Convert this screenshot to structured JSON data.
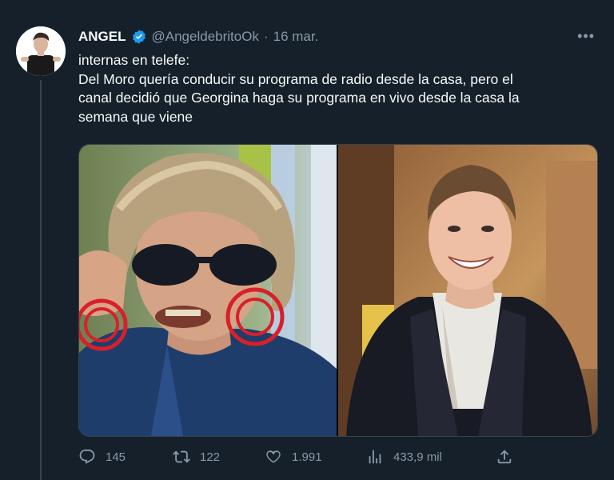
{
  "author": {
    "name": "ANGEL",
    "handle": "@AngeldebritoOk",
    "separator": "·",
    "date": "16 mar."
  },
  "tweet": {
    "lines": [
      "internas en telefe:",
      "Del Moro quería conducir su programa de radio desde la casa, pero el",
      "canal decidió que Georgina haga su programa en vivo desde la casa la",
      "semana que viene"
    ]
  },
  "actions": {
    "replies": "145",
    "retweets": "122",
    "likes": "1.991",
    "views": "433,9 mil"
  },
  "colors": {
    "background": "#15202b",
    "verified": "#1d9bf0",
    "muted": "#8b98a5"
  }
}
